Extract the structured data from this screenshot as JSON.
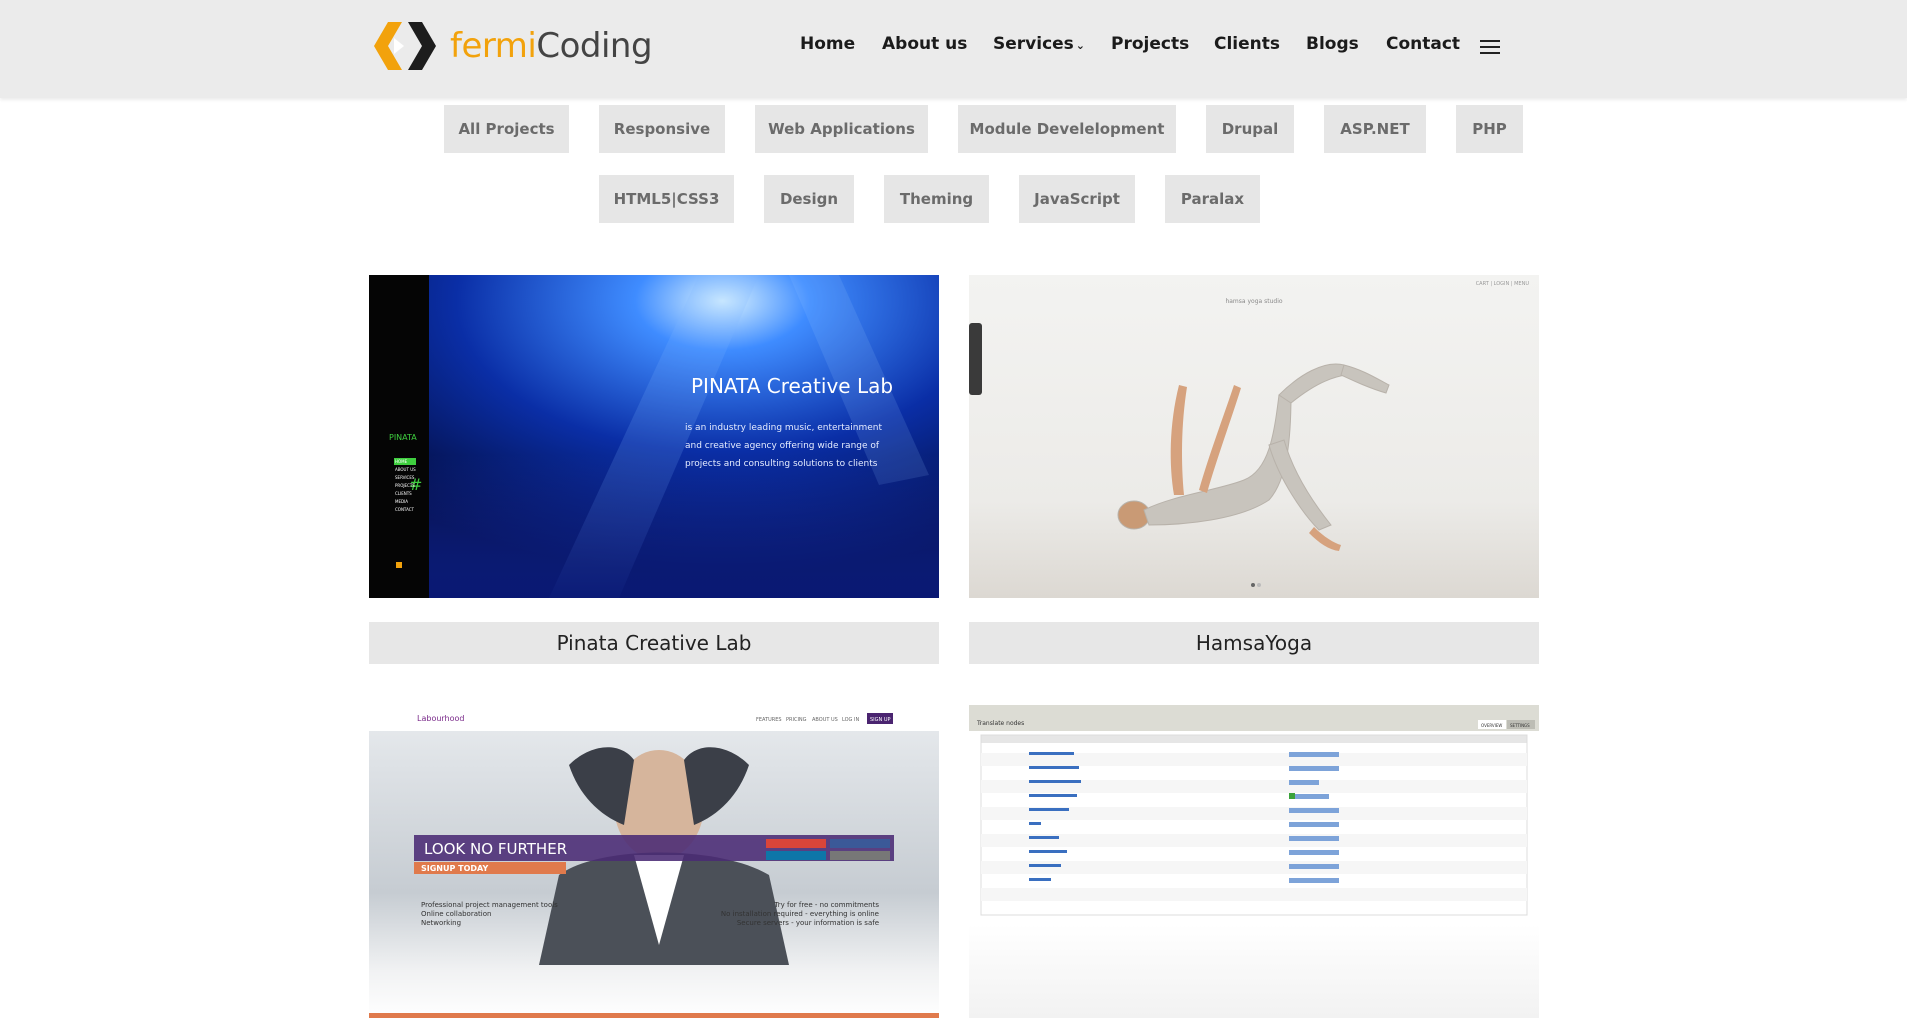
{
  "brand": {
    "part1": "fermi",
    "part2": "Coding"
  },
  "nav": {
    "items": [
      "Home",
      "About us",
      "Services",
      "Projects",
      "Clients",
      "Blogs",
      "Contact"
    ],
    "services_chevron": "⌄"
  },
  "filters": {
    "row1": [
      "All Projects",
      "Responsive",
      "Web Applications",
      "Module Develelopment",
      "Drupal",
      "ASP.NET",
      "PHP"
    ],
    "row2": [
      "HTML5|CSS3",
      "Design",
      "Theming",
      "JavaScript",
      "Paralax"
    ]
  },
  "projects": [
    {
      "title": "Pinata Creative Lab",
      "shot": {
        "brand": "PINATA",
        "heading": "PINATA Creative Lab",
        "lines": [
          "is an industry leading music, entertainment",
          "and creative agency offering wide range of",
          "projects and consulting solutions to clients"
        ],
        "menu": [
          "HOME",
          "ABOUT US",
          "SERVICES",
          "PROJECTS",
          "CLIENTS",
          "MEDIA",
          "CONTACT"
        ]
      }
    },
    {
      "title": "HamsaYoga",
      "shot": {
        "logo": "hamsa yoga studio",
        "nav": "CART | LOGIN | MENU"
      }
    },
    {
      "title": "",
      "shot": {
        "brand": "Labourhood",
        "nav": [
          "FEATURES",
          "PRICING",
          "ABOUT US",
          "LOG IN"
        ],
        "signup_nav": "SIGN UP",
        "headline": "LOOK NO FURTHER",
        "cta": "SIGNUP TODAY",
        "left_list": [
          "Professional project management tools",
          "Online collaboration",
          "Networking"
        ],
        "right_list": [
          "Try for free - no commitments",
          "No installation required - everything is online",
          "Secure servers - your information is safe"
        ]
      }
    },
    {
      "title": "",
      "shot": {
        "heading": "Translate nodes",
        "tab1": "OVERVIEW",
        "tab2": "SETTINGS"
      }
    }
  ]
}
